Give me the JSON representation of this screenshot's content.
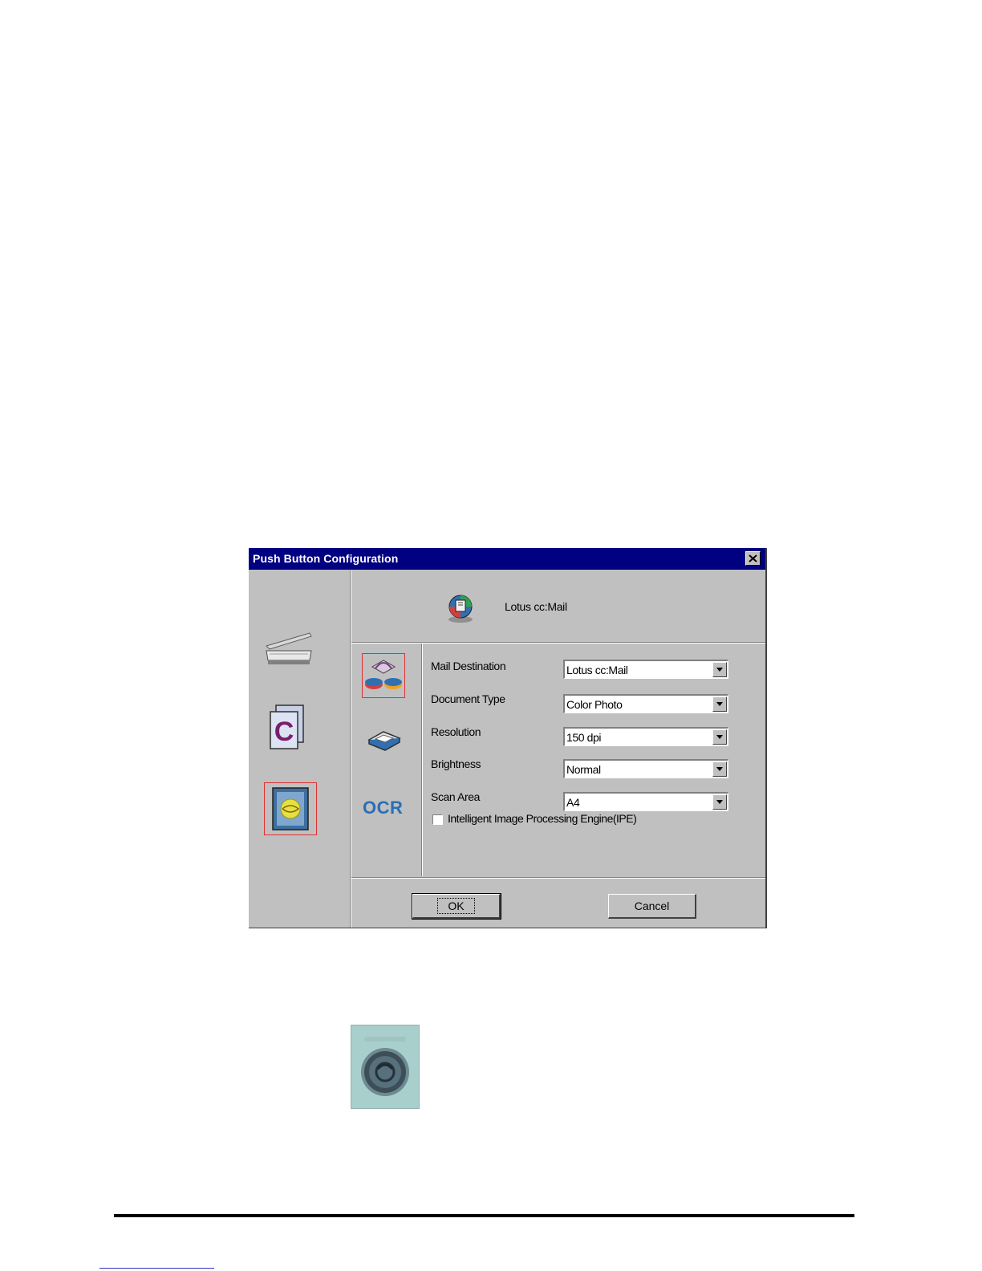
{
  "dialog": {
    "title": "Push Button Configuration",
    "header_label": "Lotus cc:Mail",
    "left_icons": [
      "scanner-icon",
      "copy-icon",
      "email-icon"
    ],
    "tab_icons": [
      "email-setting-icon",
      "scan-setting-icon",
      "ocr-icon"
    ],
    "ocr_text": "OCR",
    "fields": [
      {
        "label": "Mail Destination",
        "value": "Lotus cc:Mail"
      },
      {
        "label": "Document Type",
        "value": "Color Photo"
      },
      {
        "label": "Resolution",
        "value": "150 dpi"
      },
      {
        "label": "Brightness",
        "value": "Normal"
      },
      {
        "label": "Scan Area",
        "value": "A4"
      }
    ],
    "checkbox_label": "Intelligent Image Processing Engine(IPE)",
    "checkbox_checked": false,
    "ok_label": "OK",
    "cancel_label": "Cancel"
  },
  "colors": {
    "title_bar": "#000080",
    "dialog_face": "#c0c0c0",
    "selection_border": "#e03030",
    "ocr_text": "#2a6fb5"
  }
}
